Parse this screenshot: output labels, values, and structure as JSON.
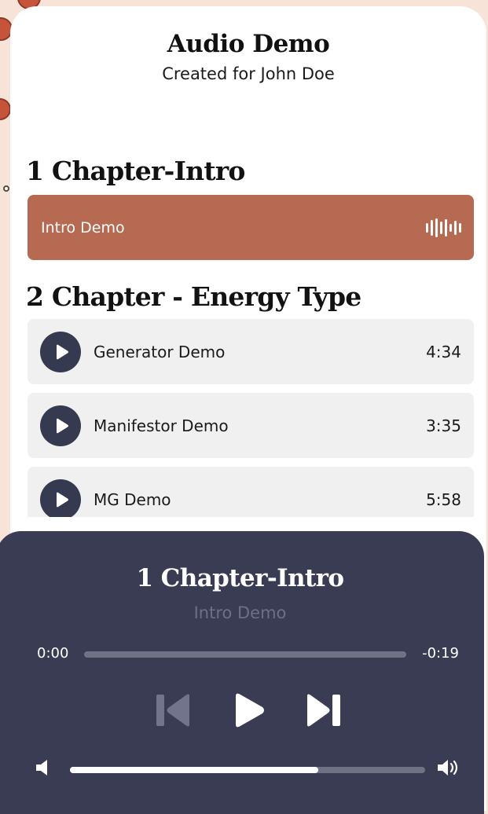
{
  "app": {
    "title": "Audio Demo",
    "subtitle": "Created for John Doe"
  },
  "chapters": [
    {
      "heading": "1 Chapter-Intro",
      "tracks": [
        {
          "name": "Intro Demo",
          "state": "active",
          "icon": "waveform-icon"
        }
      ]
    },
    {
      "heading": "2 Chapter - Energy Type",
      "tracks": [
        {
          "name": "Generator Demo",
          "duration": "4:34",
          "icon": "play-icon"
        },
        {
          "name": "Manifestor Demo",
          "duration": "3:35",
          "icon": "play-icon"
        },
        {
          "name": "MG Demo",
          "duration": "5:58",
          "icon": "play-icon"
        }
      ]
    }
  ],
  "player": {
    "chapter_title": "1 Chapter-Intro",
    "track_title": "Intro Demo",
    "elapsed": "0:00",
    "remaining": "-0:19",
    "progress_fraction": 0.0,
    "volume_fraction": 0.7,
    "controls": [
      "skip-previous-icon",
      "play-icon",
      "skip-next-icon"
    ]
  },
  "colors": {
    "background": "#f7e3d8",
    "accent": "#b56a51",
    "player_bg": "#393c52",
    "play_button": "#353a50",
    "row_bg": "#f0f0f0"
  }
}
